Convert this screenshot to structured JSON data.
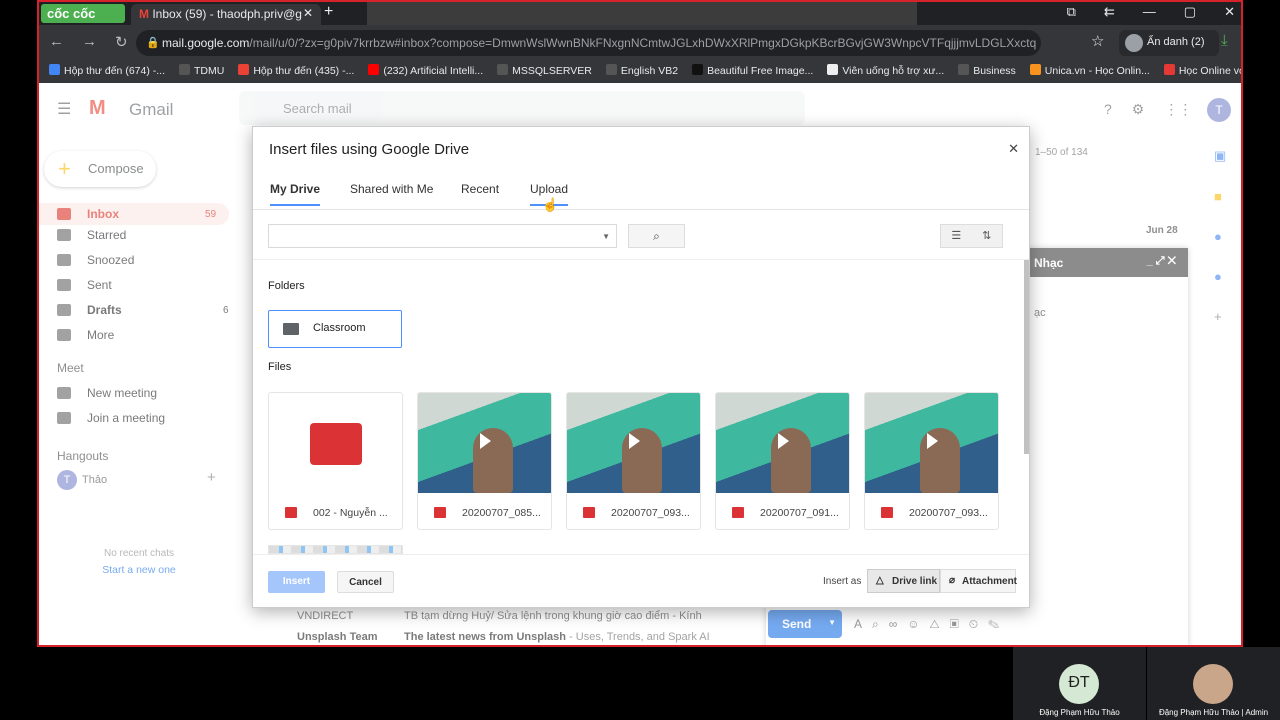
{
  "browser": {
    "brand": "cốc cốc",
    "tab_title": "Inbox (59) - thaodph.priv@g",
    "url_host": "mail.google.com",
    "url_path": "/mail/u/0/?zx=g0piv7krrbzw#inbox?compose=DmwnWslWwnBNkFNxgnNCmtwJGLxhDWxXRlPmgxDGkpKBcrBGvjGW3WnpcVTFqjjjmvLDGLXxctq",
    "profile": "Ẩn danh (2)",
    "bookmarks": [
      {
        "label": "Hộp thư đến (674) -...",
        "color": "#4285f4"
      },
      {
        "label": "TDMU",
        "color": "#555"
      },
      {
        "label": "Hộp thư đến (435) -...",
        "color": "#ea4335"
      },
      {
        "label": "(232) Artificial Intelli...",
        "color": "#ff0000"
      },
      {
        "label": "MSSQLSERVER",
        "color": "#555"
      },
      {
        "label": "English VB2",
        "color": "#555"
      },
      {
        "label": "Beautiful Free Image...",
        "color": "#111"
      },
      {
        "label": "Viên uống hỗ trợ xư...",
        "color": "#eee"
      },
      {
        "label": "Business",
        "color": "#555"
      },
      {
        "label": "Unica.vn - Học Onlin...",
        "color": "#f7931e"
      },
      {
        "label": "Học Online với 3000...",
        "color": "#e53935"
      }
    ]
  },
  "gmail": {
    "logo": "Gmail",
    "search_placeholder": "Search mail",
    "compose": "Compose",
    "pagination": "1–50 of 134",
    "date": "Jun 28",
    "nav": [
      {
        "label": "Inbox",
        "count": "59"
      },
      {
        "label": "Starred",
        "count": ""
      },
      {
        "label": "Snoozed",
        "count": ""
      },
      {
        "label": "Sent",
        "count": ""
      },
      {
        "label": "Drafts",
        "count": "6"
      },
      {
        "label": "More",
        "count": ""
      }
    ],
    "meet_title": "Meet",
    "meet_items": [
      "New meeting",
      "Join a meeting"
    ],
    "hangouts_title": "Hangouts",
    "hangouts_user": "Thảo",
    "hangouts_initial": "T",
    "no_chats": "No recent chats",
    "start_chat": "Start a new one",
    "avatar": "T",
    "rows": [
      {
        "sender": "VNDIRECT",
        "subject": "TB tạm dừng Huỷ/ Sửa lệnh trong khung giờ cao điểm - Kính",
        "snippet": ""
      },
      {
        "sender": "Unsplash Team",
        "subject": "The latest news from Unsplash",
        "snippet": " - Uses, Trends, and Spark AI"
      }
    ],
    "compose_window": {
      "title": "Nhạc",
      "body_fragment": "ạc",
      "send": "Send"
    }
  },
  "dialog": {
    "title": "Insert files using Google Drive",
    "tabs": [
      "My Drive",
      "Shared with Me",
      "Recent",
      "Upload"
    ],
    "selected_tab": "My Drive",
    "folders_label": "Folders",
    "folders": [
      "Classroom"
    ],
    "files_label": "Files",
    "files": [
      {
        "name": "002 - Nguyễn ...",
        "thumb": "video-icon"
      },
      {
        "name": "20200707_085...",
        "thumb": "video"
      },
      {
        "name": "20200707_093...",
        "thumb": "video"
      },
      {
        "name": "20200707_091...",
        "thumb": "video"
      },
      {
        "name": "20200707_093...",
        "thumb": "video"
      }
    ],
    "insert": "Insert",
    "cancel": "Cancel",
    "insert_as": "Insert as",
    "drive_link": "Drive link",
    "attachment": "Attachment"
  },
  "meeting": {
    "participants": [
      {
        "initials": "ĐT",
        "name": "Đặng Phạm Hữu Thảo"
      },
      {
        "initials": "",
        "name": "Đặng Phạm Hữu Thảo | Admin"
      }
    ]
  }
}
